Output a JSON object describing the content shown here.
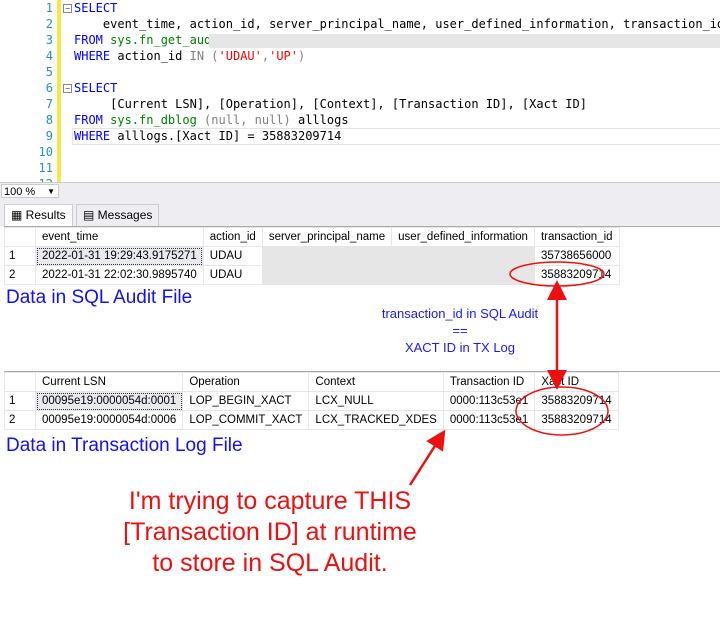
{
  "editor": {
    "lines": [
      {
        "n": "1",
        "parts": [
          [
            "kw",
            "SELECT"
          ]
        ]
      },
      {
        "n": "2",
        "parts": [
          [
            "",
            "    event_time, action_id, server_principal_name, user_defined_information, transaction_id"
          ]
        ]
      },
      {
        "n": "3",
        "parts": [
          [
            "kw",
            "FROM "
          ],
          [
            "fn",
            "sys.fn_get_audit_file("
          ],
          [
            "str",
            "'\\\\"
          ]
        ]
      },
      {
        "n": "4",
        "parts": [
          [
            "kw",
            "WHERE "
          ],
          [
            "",
            "action_id "
          ],
          [
            "gr",
            "IN ("
          ],
          [
            "str",
            "'UDAU'"
          ],
          [
            "gr",
            ","
          ],
          [
            "str",
            "'UP'"
          ],
          [
            "gr",
            ")"
          ]
        ]
      },
      {
        "n": "5",
        "parts": []
      },
      {
        "n": "6",
        "parts": [
          [
            "kw",
            "SELECT"
          ]
        ]
      },
      {
        "n": "7",
        "parts": [
          [
            "",
            "     [Current LSN], [Operation], [Context], [Transaction ID], [Xact ID]"
          ]
        ]
      },
      {
        "n": "8",
        "parts": [
          [
            "kw",
            "FROM "
          ],
          [
            "fn",
            "sys.fn_dblog "
          ],
          [
            "gr",
            "(null, null) "
          ],
          [
            "",
            "alllogs"
          ]
        ]
      },
      {
        "n": "9",
        "parts": [
          [
            "kw",
            "WHERE "
          ],
          [
            "",
            "alllogs.[Xact ID] = 35883209714"
          ]
        ]
      },
      {
        "n": "10",
        "parts": []
      },
      {
        "n": "11",
        "parts": []
      },
      {
        "n": "12",
        "parts": []
      }
    ]
  },
  "zoom": {
    "value": "100 %"
  },
  "tabs": {
    "results": "Results",
    "messages": "Messages"
  },
  "grid1": {
    "headers": [
      "event_time",
      "action_id",
      "server_principal_name",
      "user_defined_information",
      "transaction_id"
    ],
    "rows": [
      [
        "1",
        "2022-01-31 19:29:43.9175271",
        "UDAU",
        "",
        "",
        "35738656000"
      ],
      [
        "2",
        "2022-01-31 22:02:30.9895740",
        "UDAU",
        "",
        "",
        "35883209714"
      ]
    ]
  },
  "grid2": {
    "headers": [
      "Current LSN",
      "Operation",
      "Context",
      "Transaction ID",
      "Xact ID"
    ],
    "rows": [
      [
        "1",
        "00095e19:0000054d:0001",
        "LOP_BEGIN_XACT",
        "LCX_NULL",
        "0000:113c53e1",
        "35883209714"
      ],
      [
        "2",
        "00095e19:0000054d:0006",
        "LOP_COMMIT_XACT",
        "LCX_TRACKED_XDES",
        "0000:113c53e1",
        "35883209714"
      ]
    ]
  },
  "annotations": {
    "audit_label": "Data in SQL Audit File",
    "log_label": "Data in Transaction Log File",
    "equality_note": [
      "transaction_id in SQL Audit",
      "==",
      "XACT ID in TX Log"
    ],
    "question": [
      "I'm trying to capture THIS",
      "[Transaction ID] at runtime",
      "to store in SQL Audit."
    ],
    "color_red": "#ee1010",
    "color_blue": "#1010ff"
  }
}
